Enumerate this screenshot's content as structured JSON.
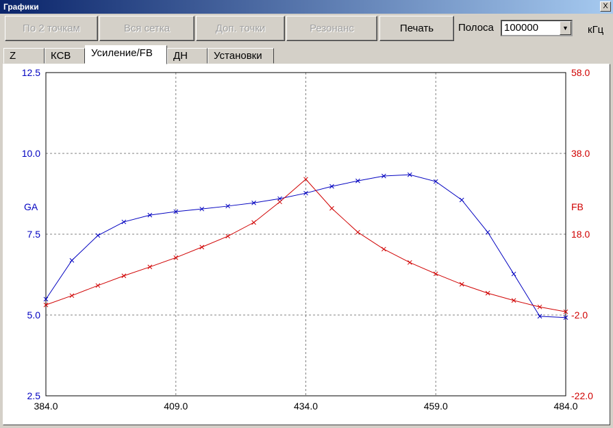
{
  "window": {
    "title": "Графики",
    "close_label": "X"
  },
  "toolbar": {
    "buttons": [
      {
        "label": "По 2 точкам",
        "enabled": false
      },
      {
        "label": "Вся сетка",
        "enabled": false
      },
      {
        "label": "Доп. точки",
        "enabled": false
      },
      {
        "label": "Резонанс",
        "enabled": false
      },
      {
        "label": "Печать",
        "enabled": true
      }
    ],
    "band_label": "Полоса",
    "band_value": "100000",
    "band_unit": "кГц"
  },
  "tabs": [
    "Z",
    "КСВ",
    "Усиление/FB",
    "ДН",
    "Установки"
  ],
  "active_tab": "Усиление/FB",
  "chart_data": {
    "type": "line",
    "x": [
      384,
      389,
      394,
      399,
      404,
      409,
      414,
      419,
      424,
      429,
      434,
      439,
      444,
      449,
      454,
      459,
      464,
      469,
      474,
      479,
      484
    ],
    "xlim": [
      384,
      484
    ],
    "xticks": [
      "384.0",
      "409.0",
      "434.0",
      "459.0",
      "484.0"
    ],
    "ylim_left": [
      2.5,
      12.5
    ],
    "yticks_left": [
      "12.5",
      "10.0",
      "7.5",
      "5.0",
      "2.5"
    ],
    "ylim_right": [
      -22,
      58
    ],
    "yticks_right": [
      "58.0",
      "38.0",
      "18.0",
      "-2.0",
      "-22.0"
    ],
    "grid": true,
    "series": [
      {
        "name": "GA",
        "axis": "left",
        "color": "#0000c0",
        "values": [
          5.49,
          6.69,
          7.46,
          7.88,
          8.09,
          8.2,
          8.28,
          8.37,
          8.47,
          8.6,
          8.77,
          8.98,
          9.15,
          9.3,
          9.34,
          9.13,
          8.56,
          7.56,
          6.27,
          4.96,
          4.92
        ]
      },
      {
        "name": "FB",
        "axis": "right",
        "color": "#d00000",
        "values": [
          0.5,
          2.8,
          5.3,
          7.7,
          9.9,
          12.2,
          14.8,
          17.5,
          20.9,
          26.0,
          31.6,
          24.4,
          18.5,
          14.3,
          11.0,
          8.2,
          5.6,
          3.4,
          1.6,
          0.0,
          -1.2
        ]
      }
    ]
  }
}
